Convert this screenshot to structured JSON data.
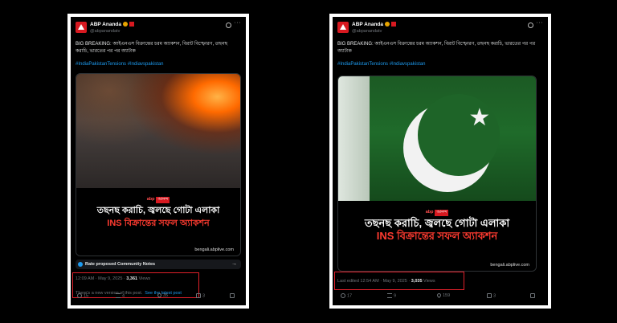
{
  "left": {
    "account_name": "ABP Ananda",
    "handle": "@abpanandatv",
    "body": "BIG BREAKING: আইএনএস বিক্রান্তের চরম অ্যাকশন, বিরাট বিস্ফোরণ, তছনছ করাচি, ভারতের পর পর অ্যাটাক",
    "hashtags": "#IndiaPakistanTensions #Indiavspakistan",
    "brand": "abp",
    "brand_tag": "আনন্দ",
    "headline_line1": "তছনছ করাচি, জ্বলছে গোটা এলাকা",
    "headline_line2": "INS বিক্রান্তের সফল অ্যাকশন",
    "site": "bengali.abplive.com",
    "notes_label": "Rate proposed Community Notes",
    "timestamp": "12:09 AM · May 9, 2025 ·",
    "views_count": "3,361",
    "views_label": "Views",
    "version_text": "There's a new version of this post.",
    "version_link": "See the latest post",
    "replies": "15",
    "reposts": "4",
    "likes": "35",
    "bookmarks": "3"
  },
  "right": {
    "account_name": "ABP Ananda",
    "handle": "@abpanandatv",
    "body": "BIG BREAKING: আইএনএস বিক্রান্তের চরম অ্যাকশন, বিরাট বিস্ফোরণ, তছনছ করাচি, ভারতের পর পর অ্যাটাক",
    "hashtags": "#IndiaPakistanTensions #Indiavspakistan",
    "brand": "abp",
    "brand_tag": "আনন্দ",
    "headline_line1": "তছনছ করাচি, জ্বলছে গোটা এলাকা",
    "headline_line2": "INS বিক্রান্তের সফল অ্যাকশন",
    "site": "bengali.abplive.com",
    "timestamp": "Last edited 12:54 AM · May 9, 2025 ·",
    "views_count": "3,035",
    "views_label": "Views",
    "replies": "17",
    "reposts": "9",
    "likes": "159",
    "bookmarks": "3"
  }
}
